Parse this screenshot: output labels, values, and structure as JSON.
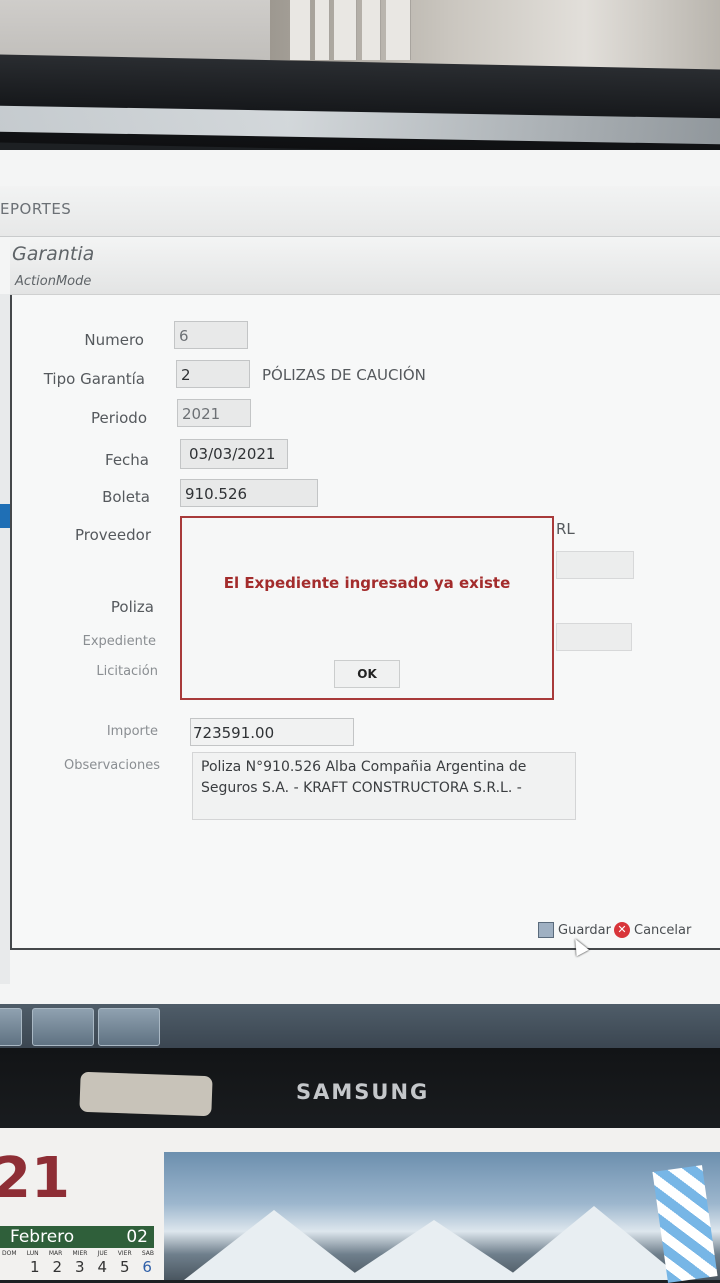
{
  "menu": {
    "label": "EPORTES"
  },
  "form": {
    "title": "Garantia",
    "subtitle": "ActionMode",
    "labels": {
      "numero": "Numero",
      "tipo_garantia": "Tipo Garantía",
      "periodo": "Periodo",
      "fecha": "Fecha",
      "boleta": "Boleta",
      "proveedor": "Proveedor",
      "poliza": "Poliza",
      "expediente": "Expediente",
      "licitacion": "Licitación",
      "importe": "Importe",
      "observaciones": "Observaciones"
    },
    "values": {
      "numero": "6",
      "tipo_garantia_code": "2",
      "tipo_garantia_desc": "PÓLIZAS DE CAUCIÓN",
      "periodo": "2021",
      "fecha": "03/03/2021",
      "boleta": "910.526",
      "proveedor_suffix": "RL",
      "importe": "723591.00",
      "observaciones_line1": "Poliza N°910.526 Alba Compañia Argentina de",
      "observaciones_line2": "Seguros S.A. - KRAFT CONSTRUCTORA S.R.L. -"
    },
    "buttons": {
      "guardar": "Guardar",
      "cancelar": "Cancelar"
    }
  },
  "dialog": {
    "message": "El Expediente ingresado ya existe",
    "ok_label": "OK"
  },
  "monitor": {
    "brand": "SAMSUNG"
  },
  "calendar": {
    "year": "21",
    "month": "Febrero",
    "month_number": "02",
    "weekdays": [
      "DOM",
      "LUN",
      "MAR",
      "MIER",
      "JUE",
      "VIER",
      "SAB"
    ],
    "days": [
      "1",
      "2",
      "3",
      "4",
      "5",
      "6"
    ]
  },
  "colors": {
    "dialog_border": "#a83a3a",
    "dialog_text": "#a32c2c",
    "cancel_icon": "#d8353a",
    "calendar_green": "#2f5f3a",
    "calendar_red": "#8e2e35"
  }
}
